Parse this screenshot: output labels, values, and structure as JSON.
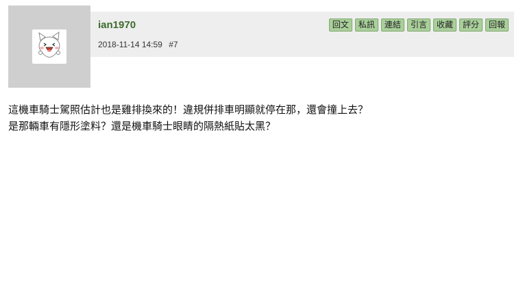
{
  "post": {
    "author": "ian1970",
    "date": "2018-11-14 14:59",
    "floor": "#7",
    "avatar_icon": "cartoon-face-icon",
    "actions": [
      "回文",
      "私訊",
      "連結",
      "引言",
      "收藏",
      "評分",
      "回報"
    ],
    "content_lines": [
      "這機車騎士駕照估計也是雞排換來的！違規併排車明顯就停在那，還會撞上去？",
      "是那輛車有隱形塗料？還是機車騎士眼睛的隔熱紙貼太黑？"
    ]
  },
  "colors": {
    "avatar_bg": "#cfcfcf",
    "header_bg": "#eeeeee",
    "username": "#3d6b2d",
    "button_bg": "#a9cf9a"
  }
}
